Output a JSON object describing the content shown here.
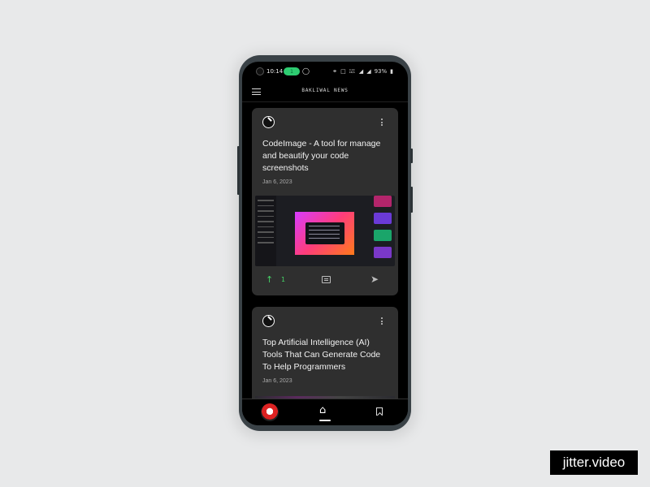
{
  "status_bar": {
    "time": "10:14",
    "pill_label": "1",
    "battery": "93%",
    "icons": [
      "headphones-icon",
      "vibrate-icon",
      "network-speed-icon",
      "signal-icon",
      "no-sim-icon",
      "battery-icon"
    ],
    "network_speed": "0.00 KB/S"
  },
  "app_bar": {
    "title": "BAKLIWAL NEWS"
  },
  "feed": {
    "posts": [
      {
        "title": "CodeImage - A tool for manage and beautify your code screenshots",
        "date": "Jan 6, 2023",
        "upvotes": "1"
      },
      {
        "title": "Top Artificial Intelligence (AI) Tools That Can Generate Code To Help Programmers",
        "date": "Jan 6, 2023"
      }
    ]
  },
  "bottom_nav": {
    "items": [
      "profile",
      "home",
      "bookmarks"
    ],
    "active": "home"
  },
  "colors": {
    "background": "#e8e9ea",
    "card": "#2f2f2f",
    "upvote_accent": "#46d366"
  },
  "watermark": {
    "text": "jitter.video"
  }
}
